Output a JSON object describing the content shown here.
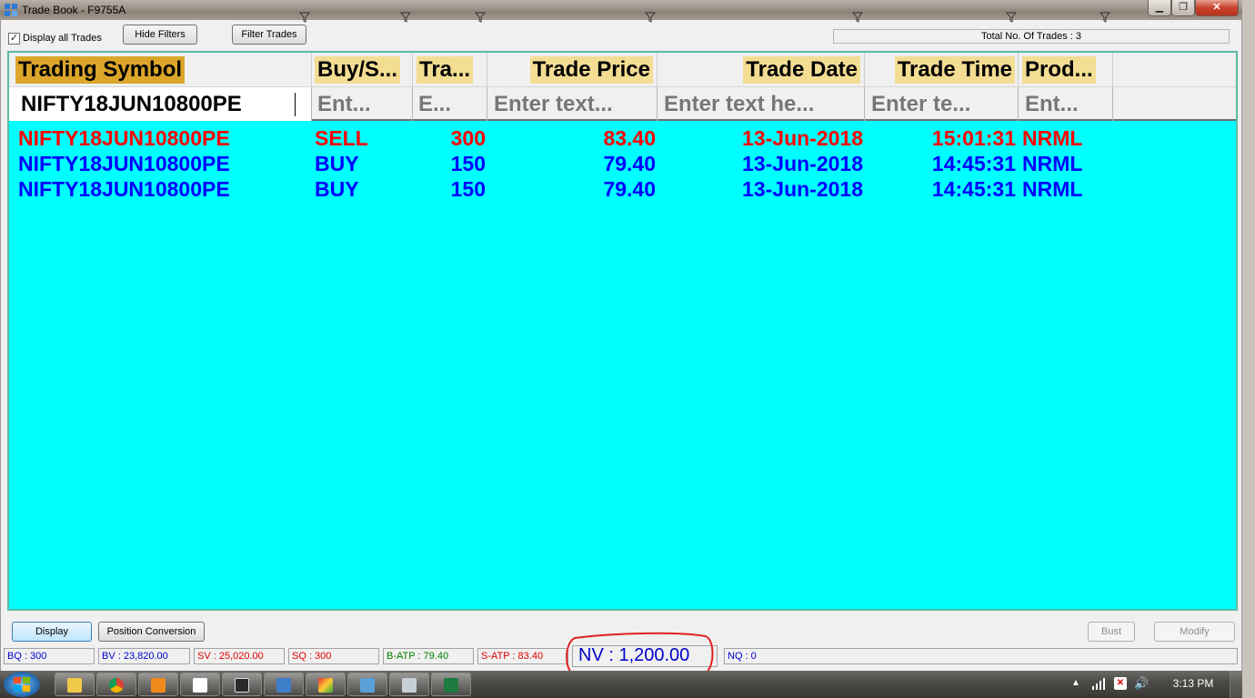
{
  "window": {
    "title": "Trade Book - F9755A",
    "controls": {
      "minimize": "▁",
      "maximize": "❐",
      "close": "✕"
    }
  },
  "toolbar": {
    "display_all_label": "Display all Trades",
    "display_all_checked": true,
    "hide_filters_label": "Hide Filters",
    "filter_trades_label": "Filter Trades",
    "total_trades_label": "Total No. Of Trades : 3"
  },
  "grid": {
    "columns": [
      {
        "label": "Trading Symbol",
        "filter_value": "NIFTY18JUN10800PE",
        "filter_placeholder": ""
      },
      {
        "label": "Buy/S...",
        "filter_value": "",
        "filter_placeholder": "Ent..."
      },
      {
        "label": "Tra...",
        "filter_value": "",
        "filter_placeholder": "E..."
      },
      {
        "label": "Trade Price",
        "filter_value": "",
        "filter_placeholder": "Enter text..."
      },
      {
        "label": "Trade Date",
        "filter_value": "",
        "filter_placeholder": "Enter text he..."
      },
      {
        "label": "Trade Time",
        "filter_value": "",
        "filter_placeholder": "Enter te..."
      },
      {
        "label": "Prod...",
        "filter_value": "",
        "filter_placeholder": "Ent..."
      }
    ],
    "rows": [
      {
        "side_color": "#ff0000",
        "cells": [
          "NIFTY18JUN10800PE",
          "SELL",
          "300",
          "83.40",
          "13-Jun-2018",
          "15:01:31",
          "NRML"
        ]
      },
      {
        "side_color": "#0000ff",
        "cells": [
          "NIFTY18JUN10800PE",
          "BUY",
          "150",
          "79.40",
          "13-Jun-2018",
          "14:45:31",
          "NRML"
        ]
      },
      {
        "side_color": "#0000ff",
        "cells": [
          "NIFTY18JUN10800PE",
          "BUY",
          "150",
          "79.40",
          "13-Jun-2018",
          "14:45:31",
          "NRML"
        ]
      }
    ],
    "background_color": "#00ffff",
    "active_header_color": "#dba62a",
    "header_label_color": "#f3dd93"
  },
  "actions": {
    "display_label": "Display",
    "position_conversion_label": "Position Conversion",
    "bust_label": "Bust",
    "modify_label": "Modify"
  },
  "status": {
    "bq": "BQ : 300",
    "bv": "BV : 23,820.00",
    "sv": "SV : 25,020.00",
    "sq": "SQ : 300",
    "b_atp": "B-ATP : 79.40",
    "s_atp": "S-ATP : 83.40",
    "nv": "NV : 1,200.00",
    "nq": "NQ : 0"
  },
  "taskbar": {
    "clock": "3:13 PM",
    "apps": [
      "explorer-icon",
      "chrome-icon",
      "media-player-icon",
      "document-icon",
      "trading-terminal-icon",
      "window-icon",
      "paint-icon",
      "tool-icon",
      "calculator-icon",
      "excel-icon"
    ]
  }
}
